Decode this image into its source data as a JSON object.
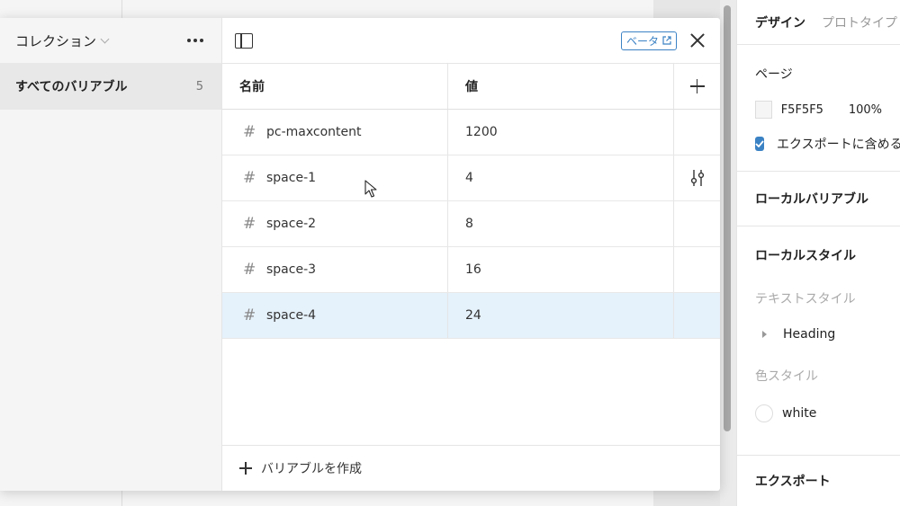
{
  "collections": {
    "title": "コレクション",
    "items": [
      {
        "label": "すべてのバリアブル",
        "count": "5"
      }
    ]
  },
  "toolbar": {
    "beta_label": "ベータ"
  },
  "table": {
    "columns": [
      "名前",
      "値"
    ],
    "rows": [
      {
        "name": "pc-maxcontent",
        "value": "1200"
      },
      {
        "name": "space-1",
        "value": "4"
      },
      {
        "name": "space-2",
        "value": "8"
      },
      {
        "name": "space-3",
        "value": "16"
      },
      {
        "name": "space-4",
        "value": "24"
      }
    ],
    "selected_row": 4
  },
  "footer": {
    "create_label": "バリアブルを作成"
  },
  "design_panel": {
    "tabs": [
      "デザイン",
      "プロトタイプ"
    ],
    "page_title": "ページ",
    "page_color_hex": "F5F5F5",
    "page_opacity": "100%",
    "export_checkbox_label": "エクスポートに含める",
    "local_variables_title": "ローカルバリアブル",
    "local_styles_title": "ローカルスタイル",
    "text_styles_title": "テキストスタイル",
    "text_style_item": "Heading",
    "color_styles_title": "色スタイル",
    "color_style_item": "white",
    "export_title": "エクスポート"
  },
  "colors": {
    "accent": "#3b82c4",
    "selected_row": "#e5f1fb",
    "page_bg": "#f5f5f5"
  }
}
